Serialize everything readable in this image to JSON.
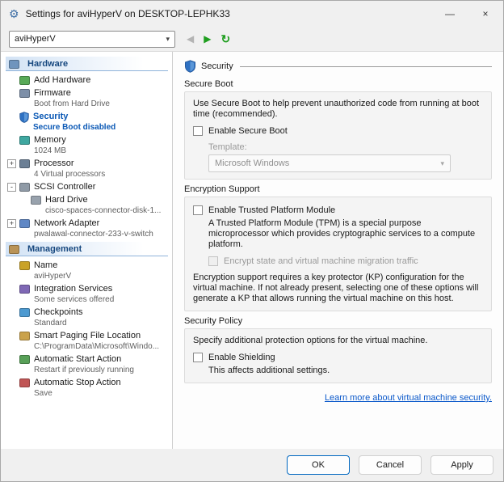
{
  "window": {
    "title": "Settings for aviHyperV on DESKTOP-LEPHK33"
  },
  "icons": {
    "gear": "⚙",
    "minimize": "—",
    "close": "×",
    "back": "◀",
    "forward": "▶",
    "refresh": "↻",
    "combo_chevron": "▾",
    "dropdown_chevron": "▾"
  },
  "toolbar": {
    "vm_selector_value": "aviHyperV"
  },
  "sidebar": {
    "sections": [
      {
        "label": "Hardware",
        "items": [
          {
            "label": "Add Hardware",
            "icon": "add-hardware-icon"
          },
          {
            "label": "Firmware",
            "sub": "Boot from Hard Drive",
            "icon": "firmware-icon"
          },
          {
            "label": "Security",
            "sub": "Secure Boot disabled",
            "icon": "security-shield-icon",
            "selected": true
          },
          {
            "label": "Memory",
            "sub": "1024 MB",
            "icon": "memory-icon"
          },
          {
            "label": "Processor",
            "sub": "4 Virtual processors",
            "icon": "processor-icon",
            "expand": "+"
          },
          {
            "label": "SCSI Controller",
            "icon": "scsi-controller-icon",
            "expand": "-"
          },
          {
            "label": "Hard Drive",
            "sub": "cisco-spaces-connector-disk-1...",
            "icon": "hard-drive-icon",
            "child": true
          },
          {
            "label": "Network Adapter",
            "sub": "pwalawal-connector-233-v-switch",
            "icon": "network-adapter-icon",
            "expand": "+"
          }
        ]
      },
      {
        "label": "Management",
        "items": [
          {
            "label": "Name",
            "sub": "aviHyperV",
            "icon": "name-icon"
          },
          {
            "label": "Integration Services",
            "sub": "Some services offered",
            "icon": "integration-services-icon"
          },
          {
            "label": "Checkpoints",
            "sub": "Standard",
            "icon": "checkpoints-icon"
          },
          {
            "label": "Smart Paging File Location",
            "sub": "C:\\ProgramData\\Microsoft\\Windo...",
            "icon": "smart-paging-icon"
          },
          {
            "label": "Automatic Start Action",
            "sub": "Restart if previously running",
            "icon": "auto-start-icon"
          },
          {
            "label": "Automatic Stop Action",
            "sub": "Save",
            "icon": "auto-stop-icon"
          }
        ]
      }
    ]
  },
  "main": {
    "header": "Security",
    "secure_boot": {
      "title": "Secure Boot",
      "desc": "Use Secure Boot to help prevent unauthorized code from running at boot time (recommended).",
      "enable_label": "Enable Secure Boot",
      "template_label": "Template:",
      "template_value": "Microsoft Windows"
    },
    "encryption": {
      "title": "Encryption Support",
      "tpm_label": "Enable Trusted Platform Module",
      "tpm_desc": "A Trusted Platform Module (TPM) is a special purpose microprocessor which provides cryptographic services to a compute platform.",
      "encrypt_label": "Encrypt state and virtual machine migration traffic",
      "kp_desc": "Encryption support requires a key protector (KP) configuration for the virtual machine. If not already present, selecting one of these options will generate a KP that allows running the virtual machine on this host."
    },
    "policy": {
      "title": "Security Policy",
      "desc": "Specify additional protection options for the virtual machine.",
      "shield_label": "Enable Shielding",
      "note": "This affects additional settings."
    },
    "link": "Learn more about virtual machine security."
  },
  "footer": {
    "ok": "OK",
    "cancel": "Cancel",
    "apply": "Apply"
  }
}
